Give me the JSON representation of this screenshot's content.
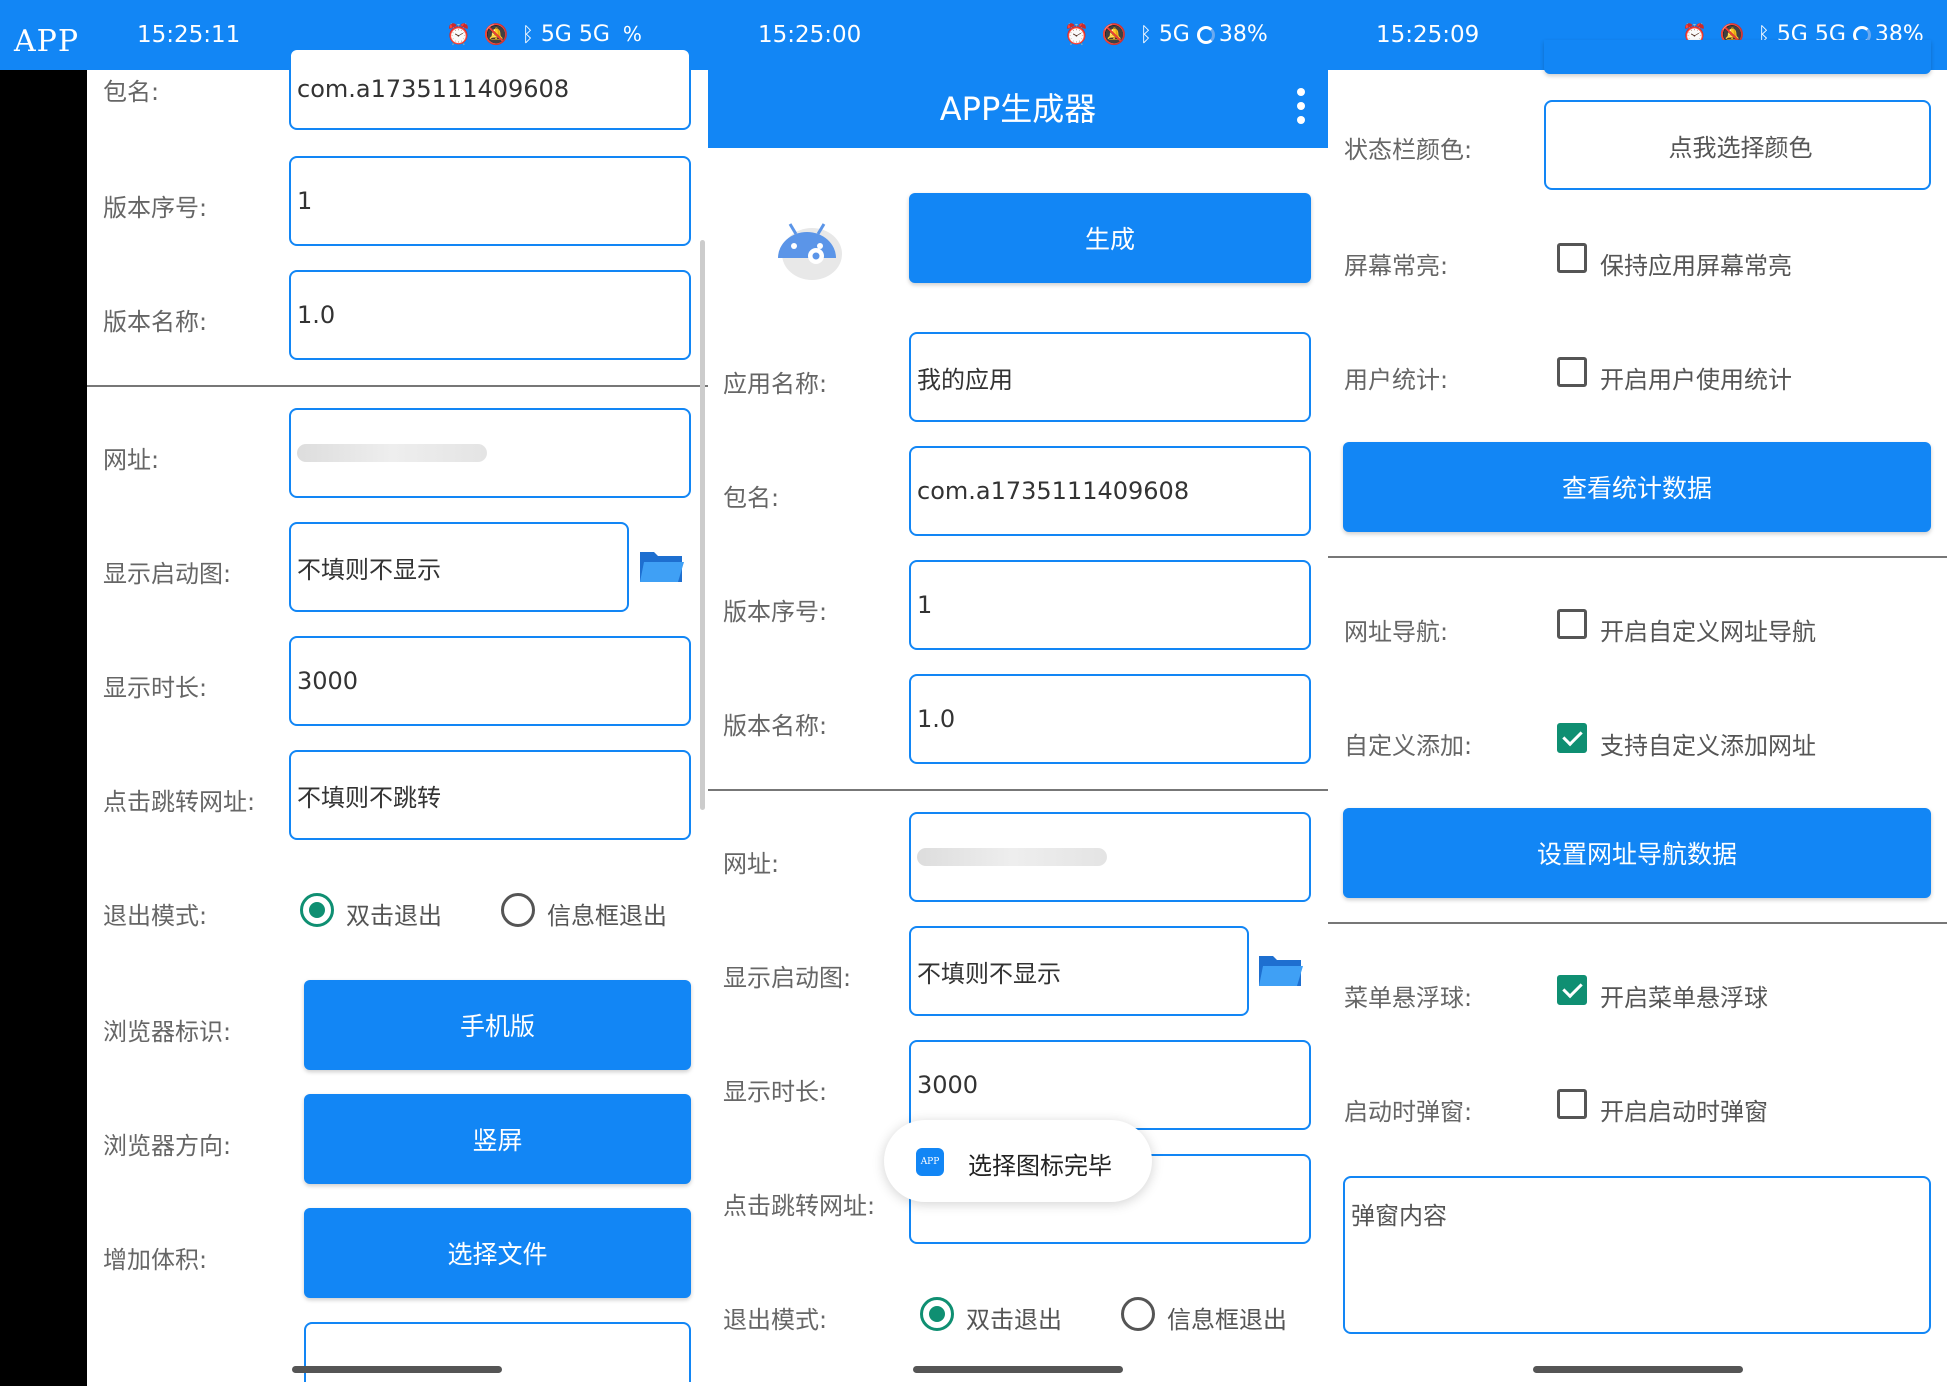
{
  "colors": {
    "primary": "#1286f5",
    "check": "#0f8f72",
    "label": "#666666"
  },
  "screen1": {
    "app_tag": "APP",
    "status": {
      "time": "15:25:11",
      "signal": "5G 5G",
      "battery": "%"
    },
    "fields": {
      "package": {
        "label": "包名:",
        "value": "com.a1735111409608"
      },
      "version_code": {
        "label": "版本序号:",
        "value": "1"
      },
      "version_name": {
        "label": "版本名称:",
        "value": "1.0"
      },
      "url": {
        "label": "网址:"
      },
      "splash": {
        "label": "显示启动图:",
        "placeholder": "不填则不显示"
      },
      "duration": {
        "label": "显示时长:",
        "value": "3000"
      },
      "jump_url": {
        "label": "点击跳转网址:",
        "placeholder": "不填则不跳转"
      }
    },
    "exit_mode": {
      "label": "退出模式:",
      "option_double": "双击退出",
      "option_dialog": "信息框退出"
    },
    "browser_ua": {
      "label": "浏览器标识:",
      "button": "手机版"
    },
    "browser_orientation": {
      "label": "浏览器方向:",
      "button": "竖屏"
    },
    "add_size": {
      "label": "增加体积:",
      "button": "选择文件"
    }
  },
  "screen2": {
    "status": {
      "time": "15:25:00",
      "signal": "5G",
      "battery": "38%"
    },
    "title": "APP生成器",
    "generate_button": "生成",
    "fields": {
      "app_name": {
        "label": "应用名称:",
        "value": "我的应用"
      },
      "package": {
        "label": "包名:",
        "value": "com.a1735111409608"
      },
      "version_code": {
        "label": "版本序号:",
        "value": "1"
      },
      "version_name": {
        "label": "版本名称:",
        "value": "1.0"
      },
      "url": {
        "label": "网址:"
      },
      "splash": {
        "label": "显示启动图:",
        "placeholder": "不填则不显示"
      },
      "duration": {
        "label": "显示时长:",
        "value": "3000"
      },
      "jump_url": {
        "label": "点击跳转网址:"
      }
    },
    "exit_mode": {
      "label": "退出模式:",
      "option_double": "双击退出",
      "option_dialog": "信息框退出"
    },
    "toast": {
      "icon_text": "APP",
      "text": "选择图标完毕"
    }
  },
  "screen3": {
    "status": {
      "time": "15:25:09",
      "signal": "5G 5G",
      "battery": "38%"
    },
    "statusbar_color": {
      "label": "状态栏颜色:",
      "button": "点我选择颜色"
    },
    "keep_screen": {
      "label": "屏幕常亮:",
      "text": "保持应用屏幕常亮",
      "checked": false
    },
    "user_stats": {
      "label": "用户统计:",
      "text": "开启用户使用统计",
      "checked": false
    },
    "view_stats_button": "查看统计数据",
    "url_nav": {
      "label": "网址导航:",
      "text": "开启自定义网址导航",
      "checked": false
    },
    "custom_add": {
      "label": "自定义添加:",
      "text": "支持自定义添加网址",
      "checked": true
    },
    "set_nav_button": "设置网址导航数据",
    "menu_ball": {
      "label": "菜单悬浮球:",
      "text": "开启菜单悬浮球",
      "checked": true
    },
    "startup_popup": {
      "label": "启动时弹窗:",
      "text": "开启启动时弹窗",
      "checked": false
    },
    "popup_content": {
      "placeholder": "弹窗内容"
    }
  }
}
